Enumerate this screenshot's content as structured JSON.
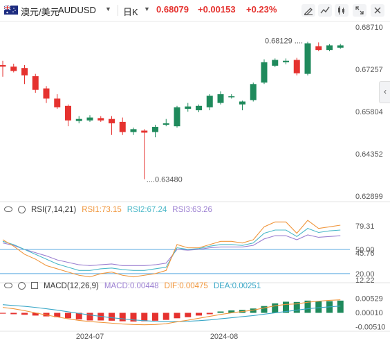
{
  "header": {
    "symbol_name": "澳元/美元",
    "symbol_code": "AUDUSD",
    "period": "日K",
    "last_price": "0.68079",
    "change": "+0.00153",
    "change_pct": "+0.23%"
  },
  "colors": {
    "up": "#1f8a5c",
    "down": "#e5322f",
    "rsi1": "#f0963c",
    "rsi2": "#4bb8c8",
    "rsi3": "#9b7fd1",
    "macd_label": "#9b7fd1",
    "dif": "#f0963c",
    "dea": "#3aa7c7",
    "guide": "#5aaae0"
  },
  "icons": [
    "au-flag-icon",
    "caret-down-icon",
    "draw-tool-icon",
    "indicator-icon",
    "compare-icon",
    "fullscreen-icon",
    "settings-icon",
    "panel-toggle-icon",
    "gear-icon",
    "eye-icon"
  ],
  "price_axis": [
    "0.68710",
    "0.67257",
    "0.65804",
    "0.64352",
    "0.62899"
  ],
  "price_annotations": {
    "high": "0.68129",
    "low": "0.63480"
  },
  "rsi": {
    "label": "RSI(7,14,21)",
    "rsi1": "RSI1:73.15",
    "rsi2": "RSI2:67.24",
    "rsi3": "RSI3:63.26",
    "axis": [
      "79.31",
      "50.00",
      "45.76",
      "20.00",
      "12.22"
    ]
  },
  "macd": {
    "label": "MACD(12,26,9)",
    "macd": "MACD:0.00448",
    "dif": "DIF:0.00475",
    "dea": "DEA:0.00251",
    "axis": [
      "0.00529",
      "0.00010",
      "-0.00510"
    ]
  },
  "x_axis": [
    "2024-07",
    "2024-08"
  ],
  "chart_data": {
    "type": "candlestick",
    "series": [
      {
        "o": 0.674,
        "h": 0.6755,
        "l": 0.67,
        "c": 0.6735
      },
      {
        "o": 0.6735,
        "h": 0.6745,
        "l": 0.6715,
        "c": 0.672
      },
      {
        "o": 0.673,
        "h": 0.674,
        "l": 0.6675,
        "c": 0.6705
      },
      {
        "o": 0.6702,
        "h": 0.671,
        "l": 0.6645,
        "c": 0.6655
      },
      {
        "o": 0.666,
        "h": 0.6668,
        "l": 0.661,
        "c": 0.6625
      },
      {
        "o": 0.6625,
        "h": 0.664,
        "l": 0.659,
        "c": 0.6595
      },
      {
        "o": 0.66,
        "h": 0.6605,
        "l": 0.653,
        "c": 0.655
      },
      {
        "o": 0.6548,
        "h": 0.6565,
        "l": 0.654,
        "c": 0.6555
      },
      {
        "o": 0.655,
        "h": 0.6568,
        "l": 0.6545,
        "c": 0.656
      },
      {
        "o": 0.6558,
        "h": 0.6565,
        "l": 0.6545,
        "c": 0.655
      },
      {
        "o": 0.6555,
        "h": 0.6565,
        "l": 0.65,
        "c": 0.654
      },
      {
        "o": 0.6545,
        "h": 0.656,
        "l": 0.65,
        "c": 0.651
      },
      {
        "o": 0.651,
        "h": 0.6525,
        "l": 0.65,
        "c": 0.652
      },
      {
        "o": 0.6515,
        "h": 0.652,
        "l": 0.6348,
        "c": 0.6508
      },
      {
        "o": 0.651,
        "h": 0.6535,
        "l": 0.6492,
        "c": 0.6528
      },
      {
        "o": 0.6535,
        "h": 0.6555,
        "l": 0.653,
        "c": 0.654
      },
      {
        "o": 0.653,
        "h": 0.66,
        "l": 0.6525,
        "c": 0.6595
      },
      {
        "o": 0.659,
        "h": 0.661,
        "l": 0.658,
        "c": 0.6598
      },
      {
        "o": 0.6585,
        "h": 0.6605,
        "l": 0.6578,
        "c": 0.66
      },
      {
        "o": 0.6595,
        "h": 0.664,
        "l": 0.6585,
        "c": 0.6635
      },
      {
        "o": 0.661,
        "h": 0.665,
        "l": 0.6605,
        "c": 0.664
      },
      {
        "o": 0.663,
        "h": 0.664,
        "l": 0.6625,
        "c": 0.6633
      },
      {
        "o": 0.6605,
        "h": 0.6618,
        "l": 0.6585,
        "c": 0.6615
      },
      {
        "o": 0.662,
        "h": 0.668,
        "l": 0.6615,
        "c": 0.6675
      },
      {
        "o": 0.668,
        "h": 0.676,
        "l": 0.6675,
        "c": 0.675
      },
      {
        "o": 0.6738,
        "h": 0.6763,
        "l": 0.6733,
        "c": 0.6758
      },
      {
        "o": 0.675,
        "h": 0.6763,
        "l": 0.6743,
        "c": 0.6755
      },
      {
        "o": 0.6758,
        "h": 0.6765,
        "l": 0.6705,
        "c": 0.6712
      },
      {
        "o": 0.671,
        "h": 0.682,
        "l": 0.6705,
        "c": 0.6815
      },
      {
        "o": 0.6805,
        "h": 0.6818,
        "l": 0.6788,
        "c": 0.6792
      },
      {
        "o": 0.6792,
        "h": 0.6812,
        "l": 0.6788,
        "c": 0.6808
      },
      {
        "o": 0.68,
        "h": 0.6813,
        "l": 0.6796,
        "c": 0.6808
      }
    ],
    "ylim": [
      0.62899,
      0.6871
    ],
    "rsi1": [
      62,
      54,
      44,
      38,
      30,
      26,
      22,
      18,
      16,
      20,
      22,
      18,
      16,
      18,
      20,
      24,
      56,
      52,
      52,
      56,
      60,
      60,
      58,
      62,
      78,
      84,
      84,
      70,
      86,
      76,
      78,
      80
    ],
    "rsi2": [
      60,
      56,
      50,
      44,
      38,
      32,
      28,
      24,
      24,
      26,
      27,
      25,
      24,
      24,
      26,
      28,
      52,
      50,
      51,
      54,
      56,
      56,
      55,
      58,
      70,
      74,
      74,
      66,
      76,
      71,
      73,
      74
    ],
    "rsi3": [
      58,
      55,
      50,
      46,
      42,
      37,
      34,
      31,
      30,
      31,
      32,
      30,
      30,
      30,
      31,
      33,
      50,
      49,
      50,
      52,
      53,
      53,
      53,
      55,
      63,
      67,
      67,
      62,
      68,
      65,
      66,
      67
    ],
    "rsi_ylim": [
      12.22,
      86
    ],
    "macd_hist": [
      -0.0003,
      -0.0005,
      -0.0007,
      -0.001,
      -0.0013,
      -0.0016,
      -0.002,
      -0.0024,
      -0.0028,
      -0.0028,
      -0.0029,
      -0.0031,
      -0.0032,
      -0.0031,
      -0.0029,
      -0.0026,
      -0.002,
      -0.0016,
      -0.001,
      -0.0005,
      0.0005,
      0.0009,
      0.0011,
      0.0016,
      0.0025,
      0.0035,
      0.0041,
      0.004,
      0.0045,
      0.0042,
      0.0043,
      0.0045
    ],
    "dif": [
      0.002,
      0.0015,
      0.0008,
      0.0,
      -0.0008,
      -0.0015,
      -0.0022,
      -0.0028,
      -0.0032,
      -0.0035,
      -0.0038,
      -0.0041,
      -0.0043,
      -0.0044,
      -0.0043,
      -0.004,
      -0.0033,
      -0.0027,
      -0.002,
      -0.0013,
      -0.0006,
      0.0,
      0.0005,
      0.001,
      0.0018,
      0.0026,
      0.0031,
      0.0033,
      0.0039,
      0.0043,
      0.0046,
      0.0048
    ],
    "dea": [
      0.003,
      0.0027,
      0.0024,
      0.002,
      0.0015,
      0.001,
      0.0004,
      -0.0002,
      -0.0008,
      -0.0013,
      -0.0018,
      -0.0022,
      -0.0026,
      -0.0029,
      -0.0031,
      -0.0032,
      -0.0032,
      -0.0031,
      -0.0029,
      -0.0026,
      -0.0022,
      -0.0018,
      -0.0014,
      -0.001,
      -0.0005,
      0.0,
      0.0005,
      0.001,
      0.0015,
      0.0019,
      0.0022,
      0.0025
    ],
    "macd_ylim": [
      -0.006,
      0.0065
    ]
  }
}
